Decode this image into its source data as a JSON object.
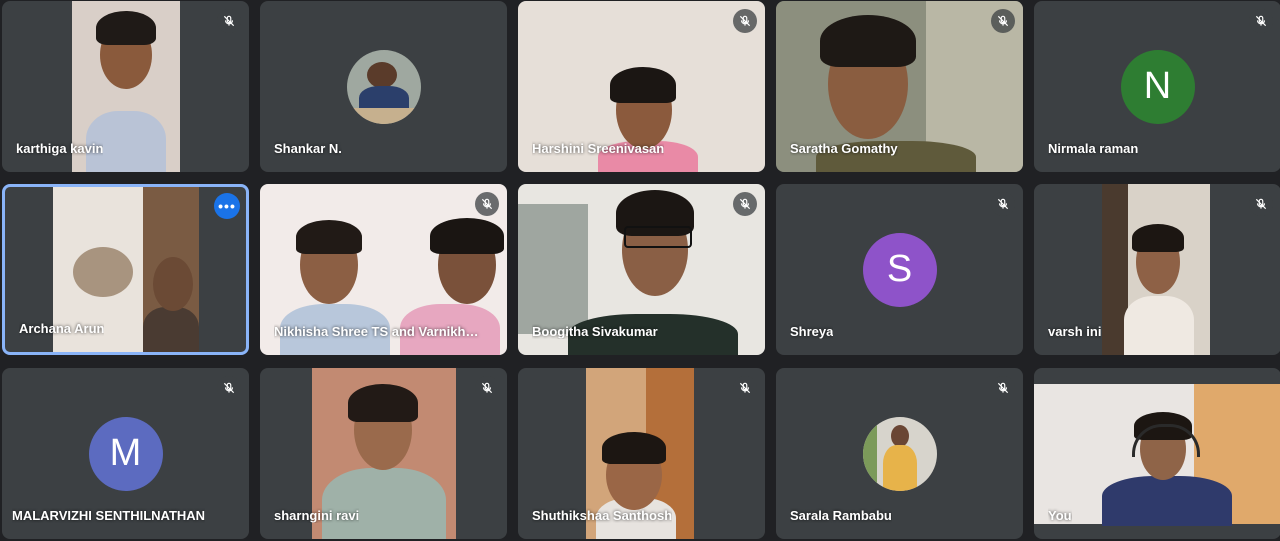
{
  "participants": [
    {
      "name": "karthiga kavin",
      "muted": true
    },
    {
      "name": "Shankar N.",
      "muted": false,
      "photo_avatar": true
    },
    {
      "name": "Harshini Sreenivasan",
      "muted": true
    },
    {
      "name": "Saratha Gomathy",
      "muted": true
    },
    {
      "name": "Nirmala raman",
      "muted": true,
      "initial": "N",
      "avatar_color": "#2e7d32"
    },
    {
      "name": "Archana Arun",
      "muted": false,
      "active": true
    },
    {
      "name": "Nikhisha Shree TS and Varnikha ...",
      "muted": true
    },
    {
      "name": "Boogitha Sivakumar",
      "muted": true
    },
    {
      "name": "Shreya",
      "muted": true,
      "initial": "S",
      "avatar_color": "#8e53c9"
    },
    {
      "name": "varsh ini",
      "muted": true
    },
    {
      "name": "MALARVIZHI SENTHILNATHAN",
      "muted": true,
      "initial": "M",
      "avatar_color": "#5c6bc0"
    },
    {
      "name": "sharngini ravi",
      "muted": true
    },
    {
      "name": "Shuthikshaa Santhosh",
      "muted": true
    },
    {
      "name": "Sarala Rambabu",
      "muted": true,
      "photo_avatar": true
    },
    {
      "name": "You",
      "muted": false
    }
  ],
  "icons": {
    "muted": "mic-off-icon",
    "more_options": "more-options-icon"
  },
  "colors": {
    "tile_bg": "#3c4043",
    "page_bg": "#202124",
    "active_border": "#8ab4f8",
    "more_button": "#1a73e8"
  }
}
